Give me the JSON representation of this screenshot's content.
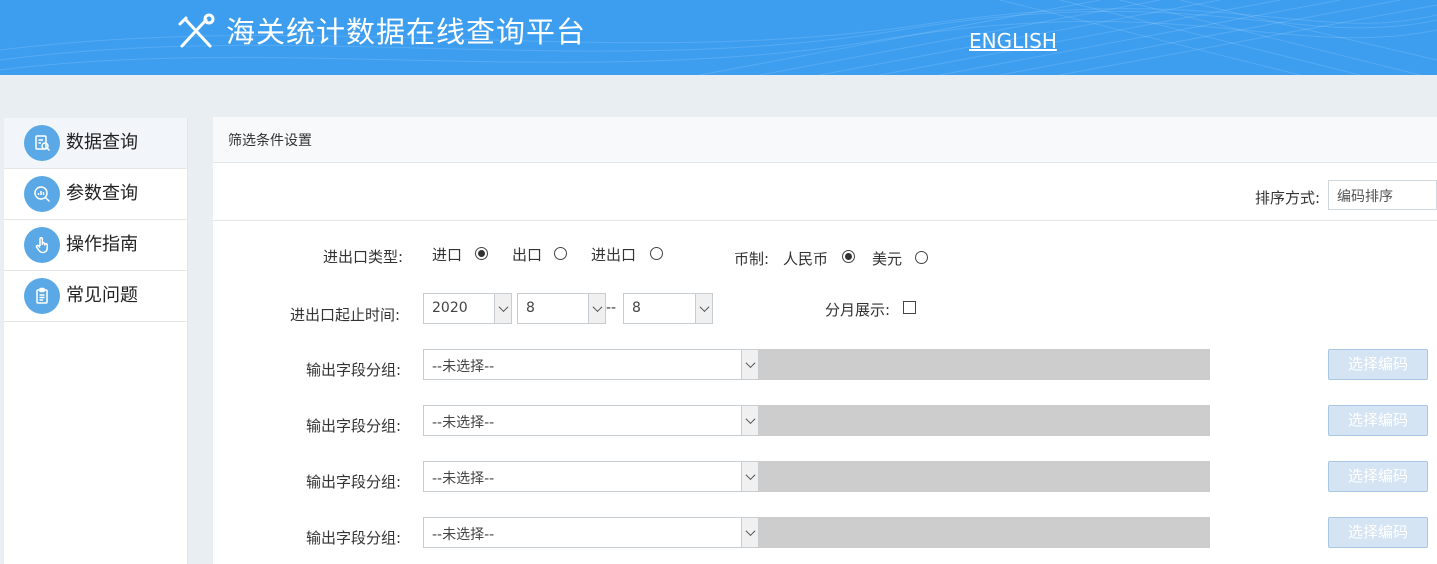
{
  "header": {
    "title": "海关统计数据在线查询平台",
    "english_link": "ENGLISH"
  },
  "sidebar": {
    "items": [
      {
        "label": "数据查询",
        "icon": "document-search-icon",
        "active": true
      },
      {
        "label": "参数查询",
        "icon": "magnifier-chart-icon",
        "active": false
      },
      {
        "label": "操作指南",
        "icon": "hand-pointer-icon",
        "active": false
      },
      {
        "label": "常见问题",
        "icon": "clipboard-icon",
        "active": false
      }
    ]
  },
  "panel": {
    "title": "筛选条件设置",
    "sort": {
      "label": "排序方式:",
      "value": "编码排序"
    },
    "trade_type": {
      "label": "进出口类型:",
      "options": [
        "进口",
        "出口",
        "进出口"
      ],
      "selected": "进口"
    },
    "currency": {
      "label": "币制:",
      "options": [
        "人民币",
        "美元"
      ],
      "selected": "人民币"
    },
    "period": {
      "label": "进出口起止时间:",
      "year": "2020",
      "month_start": "8",
      "separator": "--",
      "month_end": "8"
    },
    "monthly": {
      "label": "分月展示:",
      "checked": false
    },
    "output_groups": [
      {
        "label": "输出字段分组:",
        "value": "--未选择--",
        "button": "选择编码"
      },
      {
        "label": "输出字段分组:",
        "value": "--未选择--",
        "button": "选择编码"
      },
      {
        "label": "输出字段分组:",
        "value": "--未选择--",
        "button": "选择编码"
      },
      {
        "label": "输出字段分组:",
        "value": "--未选择--",
        "button": "选择编码"
      }
    ]
  },
  "colors": {
    "header_bg": "#3d9ef0",
    "nav_icon_bg": "#5aa9e6",
    "disabled_field": "#cdcdcd",
    "button_bg": "#d5e4f3"
  }
}
